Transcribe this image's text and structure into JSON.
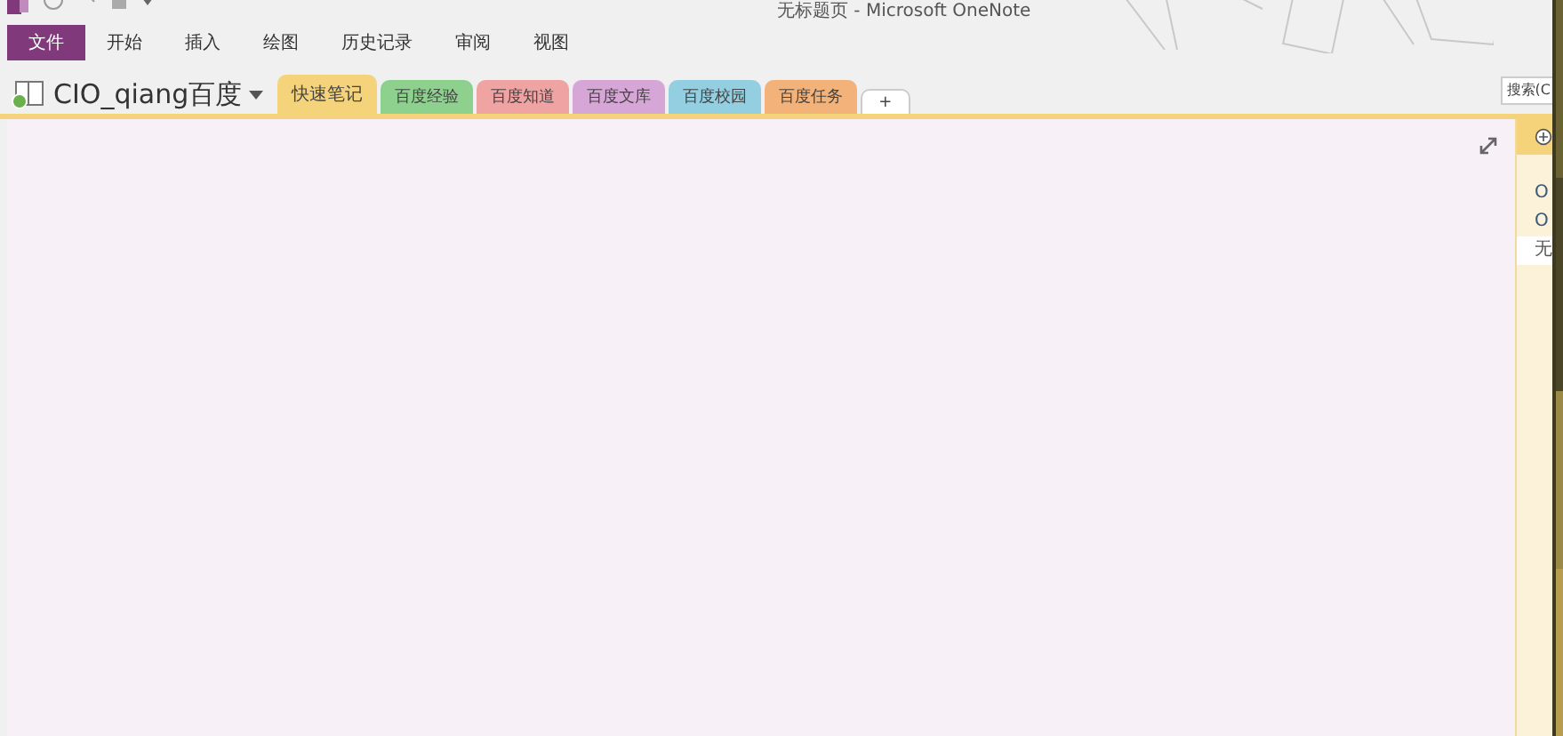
{
  "window": {
    "title": "无标题页 - Microsoft OneNote"
  },
  "ribbon_tabs": [
    {
      "label": "文件",
      "selected": true
    },
    {
      "label": "开始",
      "selected": false
    },
    {
      "label": "插入",
      "selected": false
    },
    {
      "label": "绘图",
      "selected": false
    },
    {
      "label": "历史记录",
      "selected": false
    },
    {
      "label": "审阅",
      "selected": false
    },
    {
      "label": "视图",
      "selected": false
    }
  ],
  "notebook": {
    "name": "CIO_qiang百度"
  },
  "sections": [
    {
      "label": "快速笔记",
      "color": "#f5d37a",
      "selected": true
    },
    {
      "label": "百度经验",
      "color": "#8ed18e",
      "selected": false
    },
    {
      "label": "百度知道",
      "color": "#f0a3a3",
      "selected": false
    },
    {
      "label": "百度文库",
      "color": "#d5a6d6",
      "selected": false
    },
    {
      "label": "百度校园",
      "color": "#93cfe0",
      "selected": false
    },
    {
      "label": "百度任务",
      "color": "#f2b27a",
      "selected": false
    }
  ],
  "add_section": "+",
  "search": {
    "placeholder": "搜索(C"
  },
  "pages": [
    {
      "title": "O",
      "selected": false
    },
    {
      "title": "O",
      "selected": false
    },
    {
      "title": "无",
      "selected": true
    }
  ]
}
